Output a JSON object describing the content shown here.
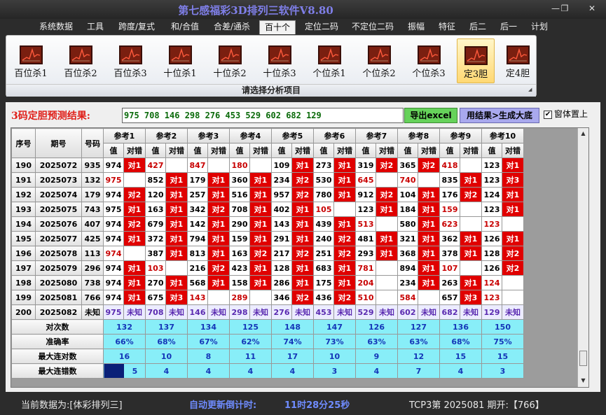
{
  "window": {
    "title": "第七感福彩3D排列三软件V8.80",
    "controls": [
      "—",
      "❐",
      "✕"
    ]
  },
  "menu": [
    "系统数据",
    "工具",
    "跨度/复式",
    "和/合值",
    "合差/通杀",
    "百十个",
    "定位二码",
    "不定位二码",
    "振幅",
    "特征",
    "后二",
    "后一",
    "计划"
  ],
  "active_menu": "百十个",
  "ribbon": {
    "buttons": [
      "百位杀1",
      "百位杀2",
      "百位杀3",
      "十位杀1",
      "十位杀2",
      "十位杀3",
      "个位杀1",
      "个位杀2",
      "个位杀3",
      "定3胆",
      "定4胆"
    ],
    "selected": "定3胆",
    "footer": "请选择分析项目"
  },
  "prediction": {
    "label": "3码定胆预测结果:",
    "value": "975 708 146 298 276 453 529 602 682 129",
    "export_button": "导出excel",
    "generate_button": "用结果>生成大底",
    "checkbox_label": "窗体置上",
    "checkbox_checked": true
  },
  "table": {
    "header": {
      "seq": "序号",
      "period": "期号",
      "number": "号码",
      "refs": [
        "参考1",
        "参考2",
        "参考3",
        "参考4",
        "参考5",
        "参考6",
        "参考7",
        "参考8",
        "参考9",
        "参考10"
      ],
      "sub_value": "值",
      "sub_result": "对错"
    },
    "rows": [
      {
        "seq": "190",
        "period": "2025072",
        "number": "935",
        "cells": [
          [
            "974",
            "对1"
          ],
          [
            "427",
            ""
          ],
          [
            "847",
            ""
          ],
          [
            "180",
            ""
          ],
          [
            "109",
            "对1"
          ],
          [
            "273",
            "对1"
          ],
          [
            "319",
            "对2"
          ],
          [
            "365",
            "对2"
          ],
          [
            "418",
            ""
          ],
          [
            "123",
            "对1"
          ]
        ]
      },
      {
        "seq": "191",
        "period": "2025073",
        "number": "132",
        "cells": [
          [
            "975",
            ""
          ],
          [
            "852",
            "对1"
          ],
          [
            "179",
            "对1"
          ],
          [
            "360",
            "对1"
          ],
          [
            "234",
            "对2"
          ],
          [
            "530",
            "对1"
          ],
          [
            "645",
            ""
          ],
          [
            "740",
            ""
          ],
          [
            "835",
            "对1"
          ],
          [
            "123",
            "对3"
          ]
        ]
      },
      {
        "seq": "192",
        "period": "2025074",
        "number": "179",
        "cells": [
          [
            "974",
            "对2"
          ],
          [
            "120",
            "对1"
          ],
          [
            "257",
            "对1"
          ],
          [
            "516",
            "对1"
          ],
          [
            "957",
            "对2"
          ],
          [
            "780",
            "对1"
          ],
          [
            "912",
            "对2"
          ],
          [
            "104",
            "对1"
          ],
          [
            "176",
            "对2"
          ],
          [
            "124",
            "对1"
          ]
        ]
      },
      {
        "seq": "193",
        "period": "2025075",
        "number": "743",
        "cells": [
          [
            "975",
            "对1"
          ],
          [
            "163",
            "对1"
          ],
          [
            "342",
            "对2"
          ],
          [
            "708",
            "对1"
          ],
          [
            "402",
            "对1"
          ],
          [
            "105",
            ""
          ],
          [
            "123",
            "对1"
          ],
          [
            "184",
            "对1"
          ],
          [
            "159",
            ""
          ],
          [
            "123",
            "对1"
          ]
        ]
      },
      {
        "seq": "194",
        "period": "2025076",
        "number": "407",
        "cells": [
          [
            "974",
            "对2"
          ],
          [
            "679",
            "对1"
          ],
          [
            "142",
            "对1"
          ],
          [
            "290",
            "对1"
          ],
          [
            "143",
            "对1"
          ],
          [
            "439",
            "对1"
          ],
          [
            "513",
            ""
          ],
          [
            "580",
            "对1"
          ],
          [
            "623",
            ""
          ],
          [
            "123",
            ""
          ]
        ]
      },
      {
        "seq": "195",
        "period": "2025077",
        "number": "425",
        "cells": [
          [
            "974",
            "对1"
          ],
          [
            "372",
            "对1"
          ],
          [
            "794",
            "对1"
          ],
          [
            "159",
            "对1"
          ],
          [
            "291",
            "对1"
          ],
          [
            "240",
            "对2"
          ],
          [
            "481",
            "对1"
          ],
          [
            "321",
            "对1"
          ],
          [
            "362",
            "对1"
          ],
          [
            "126",
            "对1"
          ]
        ]
      },
      {
        "seq": "196",
        "period": "2025078",
        "number": "113",
        "cells": [
          [
            "974",
            ""
          ],
          [
            "387",
            "对1"
          ],
          [
            "813",
            "对1"
          ],
          [
            "163",
            "对2"
          ],
          [
            "217",
            "对2"
          ],
          [
            "251",
            "对2"
          ],
          [
            "293",
            "对1"
          ],
          [
            "368",
            "对1"
          ],
          [
            "378",
            "对1"
          ],
          [
            "128",
            "对2"
          ]
        ]
      },
      {
        "seq": "197",
        "period": "2025079",
        "number": "296",
        "cells": [
          [
            "974",
            "对1"
          ],
          [
            "103",
            ""
          ],
          [
            "216",
            "对2"
          ],
          [
            "423",
            "对1"
          ],
          [
            "128",
            "对1"
          ],
          [
            "683",
            "对1"
          ],
          [
            "781",
            ""
          ],
          [
            "894",
            "对1"
          ],
          [
            "107",
            ""
          ],
          [
            "126",
            "对2"
          ]
        ]
      },
      {
        "seq": "198",
        "period": "2025080",
        "number": "738",
        "cells": [
          [
            "974",
            "对1"
          ],
          [
            "270",
            "对1"
          ],
          [
            "568",
            "对1"
          ],
          [
            "158",
            "对1"
          ],
          [
            "286",
            "对1"
          ],
          [
            "175",
            "对1"
          ],
          [
            "204",
            ""
          ],
          [
            "234",
            "对1"
          ],
          [
            "263",
            "对1"
          ],
          [
            "124",
            ""
          ]
        ]
      },
      {
        "seq": "199",
        "period": "2025081",
        "number": "766",
        "cells": [
          [
            "974",
            "对1"
          ],
          [
            "675",
            "对3"
          ],
          [
            "143",
            ""
          ],
          [
            "289",
            ""
          ],
          [
            "346",
            "对2"
          ],
          [
            "436",
            "对2"
          ],
          [
            "510",
            ""
          ],
          [
            "584",
            ""
          ],
          [
            "657",
            "对3"
          ],
          [
            "123",
            ""
          ]
        ]
      },
      {
        "seq": "200",
        "period": "2025082",
        "number": "未知",
        "cells": [
          [
            "975",
            "未知"
          ],
          [
            "708",
            "未知"
          ],
          [
            "146",
            "未知"
          ],
          [
            "298",
            "未知"
          ],
          [
            "276",
            "未知"
          ],
          [
            "453",
            "未知"
          ],
          [
            "529",
            "未知"
          ],
          [
            "602",
            "未知"
          ],
          [
            "682",
            "未知"
          ],
          [
            "129",
            "未知"
          ]
        ]
      }
    ],
    "stats": [
      {
        "label": "对次数",
        "values": [
          "132",
          "137",
          "134",
          "125",
          "148",
          "147",
          "126",
          "127",
          "136",
          "150"
        ]
      },
      {
        "label": "准确率",
        "values": [
          "66%",
          "68%",
          "67%",
          "62%",
          "74%",
          "73%",
          "63%",
          "63%",
          "68%",
          "75%"
        ]
      },
      {
        "label": "最大连对数",
        "values": [
          "16",
          "10",
          "8",
          "11",
          "17",
          "10",
          "9",
          "12",
          "15",
          "15"
        ]
      },
      {
        "label": "最大连错数",
        "values": [
          "5",
          "4",
          "4",
          "4",
          "4",
          "3",
          "4",
          "7",
          "4",
          "3"
        ]
      }
    ]
  },
  "status": {
    "source_label": "当前数据为:[体彩排列三]",
    "countdown_label": "自动更新倒计时:",
    "countdown_value": "11时28分25秒",
    "last_draw": "TCP3第 2025081 期开:【766】"
  },
  "colors": {
    "hit": "#e00000",
    "stat_bg": "#88eef8",
    "stat_text": "#1436b8",
    "excel_button": "#66d25a",
    "generate_button": "#a9a9ee",
    "prediction_text": "#0a6a0a",
    "title": "#7f7fe8"
  },
  "icons": {
    "ribbon": "line-chart-icon",
    "minimize": "minimize-icon",
    "maximize": "maximize-icon",
    "close": "close-icon"
  }
}
